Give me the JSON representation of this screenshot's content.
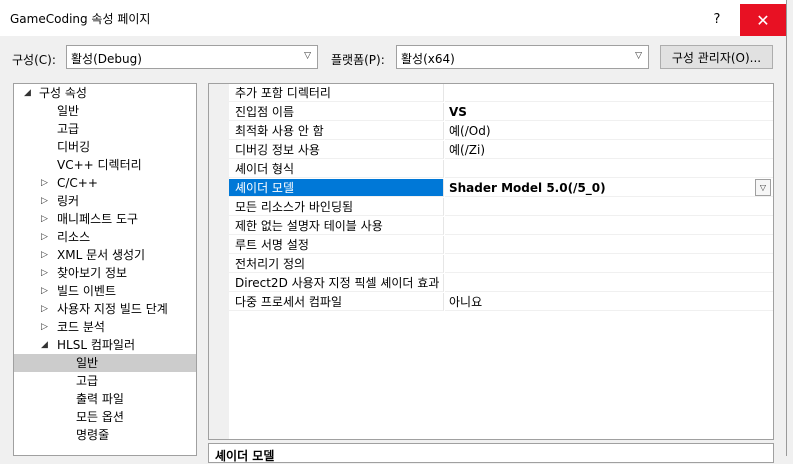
{
  "window": {
    "title": "GameCoding 속성 페이지",
    "help": "?",
    "close": "✕"
  },
  "toolbar": {
    "config_label": "구성(C):",
    "config_value": "활성(Debug)",
    "platform_label": "플랫폼(P):",
    "platform_value": "활성(x64)",
    "manager_button": "구성 관리자(O)..."
  },
  "tree": [
    {
      "label": "구성 속성",
      "level": 0,
      "arrow": "◢"
    },
    {
      "label": "일반",
      "level": 1,
      "arrow": ""
    },
    {
      "label": "고급",
      "level": 1,
      "arrow": ""
    },
    {
      "label": "디버깅",
      "level": 1,
      "arrow": ""
    },
    {
      "label": "VC++ 디렉터리",
      "level": 1,
      "arrow": ""
    },
    {
      "label": "C/C++",
      "level": 1,
      "arrow": "▷"
    },
    {
      "label": "링커",
      "level": 1,
      "arrow": "▷"
    },
    {
      "label": "매니페스트 도구",
      "level": 1,
      "arrow": "▷"
    },
    {
      "label": "리소스",
      "level": 1,
      "arrow": "▷"
    },
    {
      "label": "XML 문서 생성기",
      "level": 1,
      "arrow": "▷"
    },
    {
      "label": "찾아보기 정보",
      "level": 1,
      "arrow": "▷"
    },
    {
      "label": "빌드 이벤트",
      "level": 1,
      "arrow": "▷"
    },
    {
      "label": "사용자 지정 빌드 단계",
      "level": 1,
      "arrow": "▷"
    },
    {
      "label": "코드 분석",
      "level": 1,
      "arrow": "▷"
    },
    {
      "label": "HLSL 컴파일러",
      "level": 1,
      "arrow": "◢"
    },
    {
      "label": "일반",
      "level": 2,
      "arrow": "",
      "selected": true
    },
    {
      "label": "고급",
      "level": 2,
      "arrow": ""
    },
    {
      "label": "출력 파일",
      "level": 2,
      "arrow": ""
    },
    {
      "label": "모든 옵션",
      "level": 2,
      "arrow": ""
    },
    {
      "label": "명령줄",
      "level": 2,
      "arrow": ""
    }
  ],
  "properties": [
    {
      "name": "추가 포함 디렉터리",
      "value": ""
    },
    {
      "name": "진입점 이름",
      "value": "VS",
      "bold": true
    },
    {
      "name": "최적화 사용 안 함",
      "value": "예(/Od)"
    },
    {
      "name": "디버깅 정보 사용",
      "value": "예(/Zi)"
    },
    {
      "name": "셰이더 형식",
      "value": ""
    },
    {
      "name": "셰이더 모델",
      "value": "Shader Model 5.0(/5_0)",
      "bold": true,
      "selected": true,
      "dropdown": true
    },
    {
      "name": "모든 리소스가 바인딩됨",
      "value": ""
    },
    {
      "name": "제한 없는 설명자 테이블 사용",
      "value": ""
    },
    {
      "name": "루트 서명 설정",
      "value": ""
    },
    {
      "name": "전처리기 정의",
      "value": ""
    },
    {
      "name": "Direct2D 사용자 지정 픽셀 셰이더 효과",
      "value": ""
    },
    {
      "name": "다중 프로세서 컴파일",
      "value": "아니요"
    }
  ],
  "description": {
    "title": "셰이더 모델"
  },
  "colors": {
    "selection": "#0078d7",
    "close": "#e81123",
    "tree_selection": "#cccccc"
  }
}
